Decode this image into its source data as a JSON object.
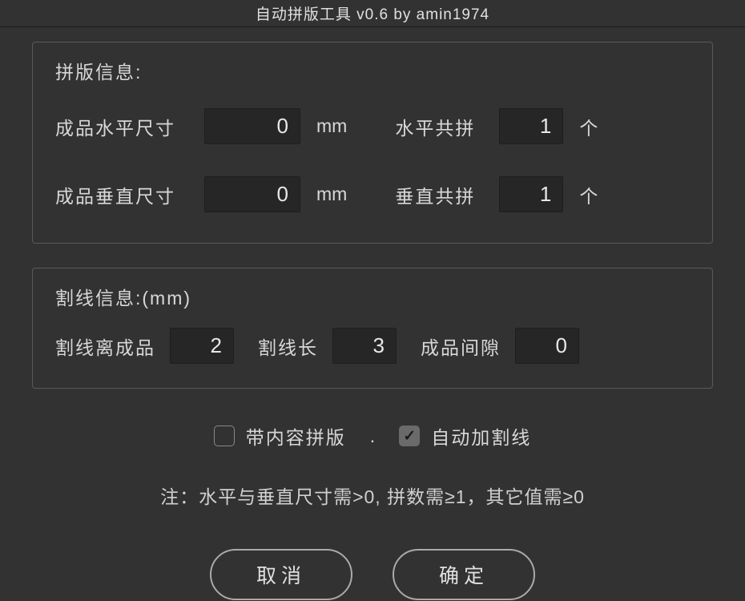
{
  "window": {
    "title": "自动拼版工具 v0.6   by amin1974"
  },
  "layout_info": {
    "section_title": "拼版信息:",
    "horiz_size_label": "成品水平尺寸",
    "horiz_size_value": "0",
    "horiz_size_unit": "mm",
    "horiz_count_label": "水平共拼",
    "horiz_count_value": "1",
    "horiz_count_unit": "个",
    "vert_size_label": "成品垂直尺寸",
    "vert_size_value": "0",
    "vert_size_unit": "mm",
    "vert_count_label": "垂直共拼",
    "vert_count_value": "1",
    "vert_count_unit": "个"
  },
  "cutline_info": {
    "section_title": "割线信息:(mm)",
    "offset_label": "割线离成品",
    "offset_value": "2",
    "length_label": "割线长",
    "length_value": "3",
    "gap_label": "成品间隙",
    "gap_value": "0"
  },
  "options": {
    "with_content_label": "带内容拼版",
    "with_content_checked": false,
    "separator": ".",
    "auto_cutline_label": "自动加割线",
    "auto_cutline_checked": true
  },
  "note": "注：水平与垂直尺寸需>0, 拼数需≥1，其它值需≥0",
  "buttons": {
    "cancel": "取消",
    "ok": "确定"
  }
}
